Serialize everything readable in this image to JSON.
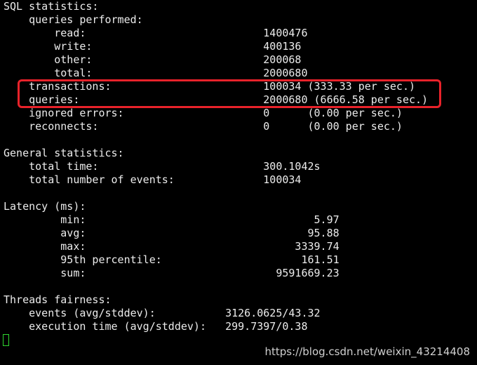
{
  "lines": [
    "SQL statistics:",
    "    queries performed:",
    "        read:                            1400476",
    "        write:                           400136",
    "        other:                           200068",
    "        total:                           2000680",
    "    transactions:                        100034 (333.33 per sec.)",
    "    queries:                             2000680 (6666.58 per sec.)",
    "    ignored errors:                      0      (0.00 per sec.)",
    "    reconnects:                          0      (0.00 per sec.)",
    "",
    "General statistics:",
    "    total time:                          300.1042s",
    "    total number of events:              100034",
    "",
    "Latency (ms):",
    "         min:                                    5.97",
    "         avg:                                   95.88",
    "         max:                                 3339.74",
    "         95th percentile:                      161.51",
    "         sum:                              9591669.23",
    "",
    "Threads fairness:",
    "    events (avg/stddev):           3126.0625/43.32",
    "    execution time (avg/stddev):   299.7397/0.38"
  ],
  "watermark": "https://blog.csdn.net/weixin_43214408",
  "colors": {
    "background": "#000000",
    "text": "#ececec",
    "highlight": "#e8222a",
    "cursor": "#2fd62f"
  }
}
